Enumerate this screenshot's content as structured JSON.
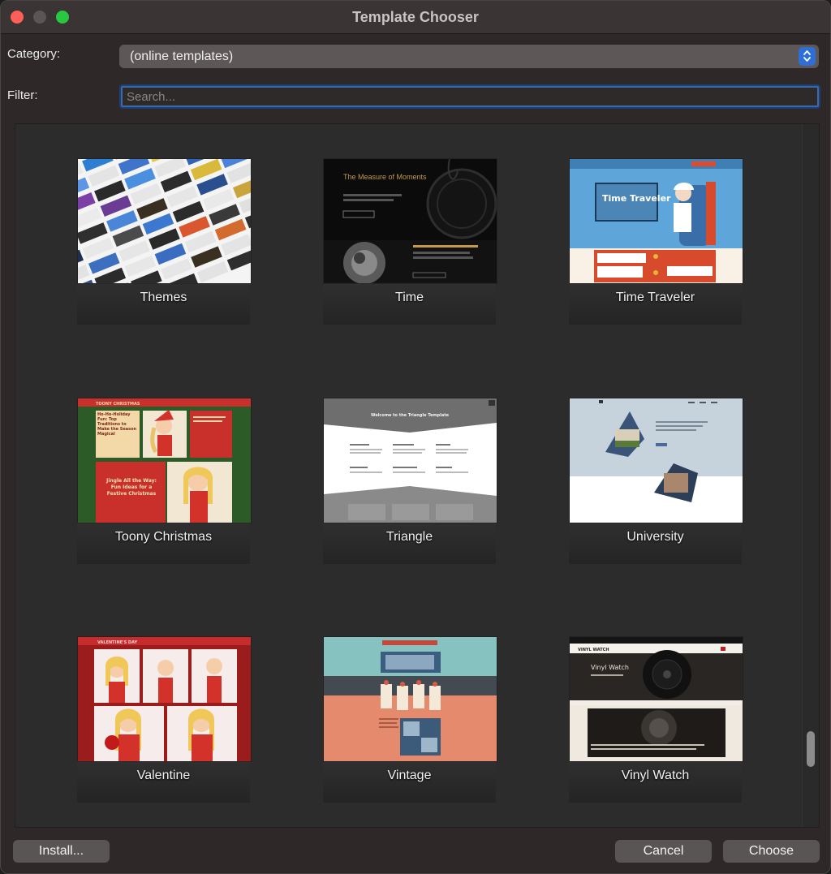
{
  "window": {
    "title": "Template Chooser"
  },
  "category": {
    "label": "Category:",
    "value": "(online templates)"
  },
  "filter": {
    "label": "Filter:",
    "placeholder": "Search..."
  },
  "templates": [
    {
      "name": "Themes"
    },
    {
      "name": "Time"
    },
    {
      "name": "Time Traveler"
    },
    {
      "name": "Toony Christmas"
    },
    {
      "name": "Triangle"
    },
    {
      "name": "University"
    },
    {
      "name": "Valentine"
    },
    {
      "name": "Vintage"
    },
    {
      "name": "Vinyl Watch"
    }
  ],
  "thumbnail_text": {
    "time_heading": "The Measure of Moments",
    "time_traveler_logo": "Time Traveler",
    "toony_christmas_title": "TOONY CHRISTMAS",
    "toony_christmas_caption": "Ho-Ho-Holiday Fun: Top Traditions to Make the Season Magical",
    "toony_christmas_caption2": "Jingle All the Way: Fun Ideas for a Festive Christmas",
    "triangle_heading": "Welcome to the Triangle Template",
    "valentine_title": "VALENTINE'S DAY",
    "vinyl_watch_title": "VINYL WATCH",
    "vinyl_watch_heading": "Vinyl Watch"
  },
  "buttons": {
    "install": "Install...",
    "cancel": "Cancel",
    "choose": "Choose"
  },
  "colors": {
    "window_bg": "#2e2828",
    "accent": "#2d6fd6",
    "close": "#fe5f57",
    "maximize": "#28c840"
  }
}
